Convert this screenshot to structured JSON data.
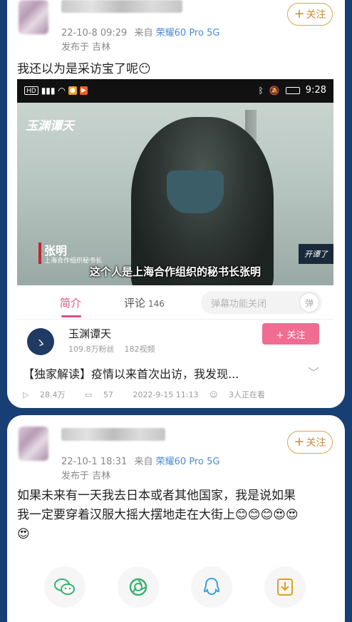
{
  "post1": {
    "timestamp": "22-10-8 09:29",
    "source_prefix": "来自",
    "device": "荣耀60 Pro 5G",
    "location": "发布于 吉林",
    "follow_label": "关注",
    "text": "我还以为是采访宝了呢😶",
    "embed": {
      "status_time": "9:28",
      "channel_logo": "玉渊谭天",
      "person_name": "张明",
      "person_title": "上海合作组织秘书长",
      "subtitle": "这个人是上海合作组织的秘书长张明",
      "corner_tag": "开谭了",
      "tab_intro": "简介",
      "tab_comments": "评论",
      "comments_count": "146",
      "danmu_label": "弹幕功能关闭",
      "danmu_toggle": "弹",
      "channel_name": "玉渊谭天",
      "channel_fans": "109.8万粉丝",
      "channel_videos": "182视频",
      "subscribe_label": "+ 关注",
      "video_title": "【独家解读】疫情以来首次出访，我发现...",
      "plays": "28.4万",
      "danmaku_count": "57",
      "publish_time": "2022-9-15 11:13",
      "watching": "3人正在看"
    }
  },
  "post2": {
    "timestamp": "22-10-1 18:31",
    "source_prefix": "来自",
    "device": "荣耀60 Pro 5G",
    "location": "发布于 吉林",
    "follow_label": "关注",
    "text_line1": "如果未来有一天我去日本或者其他国家，我是说如果",
    "text_line2": "我一定要穿着汉服大摇大摆地走在大街上😊😊😊😍😍",
    "text_line3": "😍"
  },
  "share": [
    "wechat-icon",
    "moments-icon",
    "qq-icon",
    "save-icon"
  ],
  "colors": {
    "background": "#173f73",
    "accent_pink": "#e0507e",
    "follow_orange": "#c98a3a",
    "device_blue": "#4a8bd6"
  }
}
